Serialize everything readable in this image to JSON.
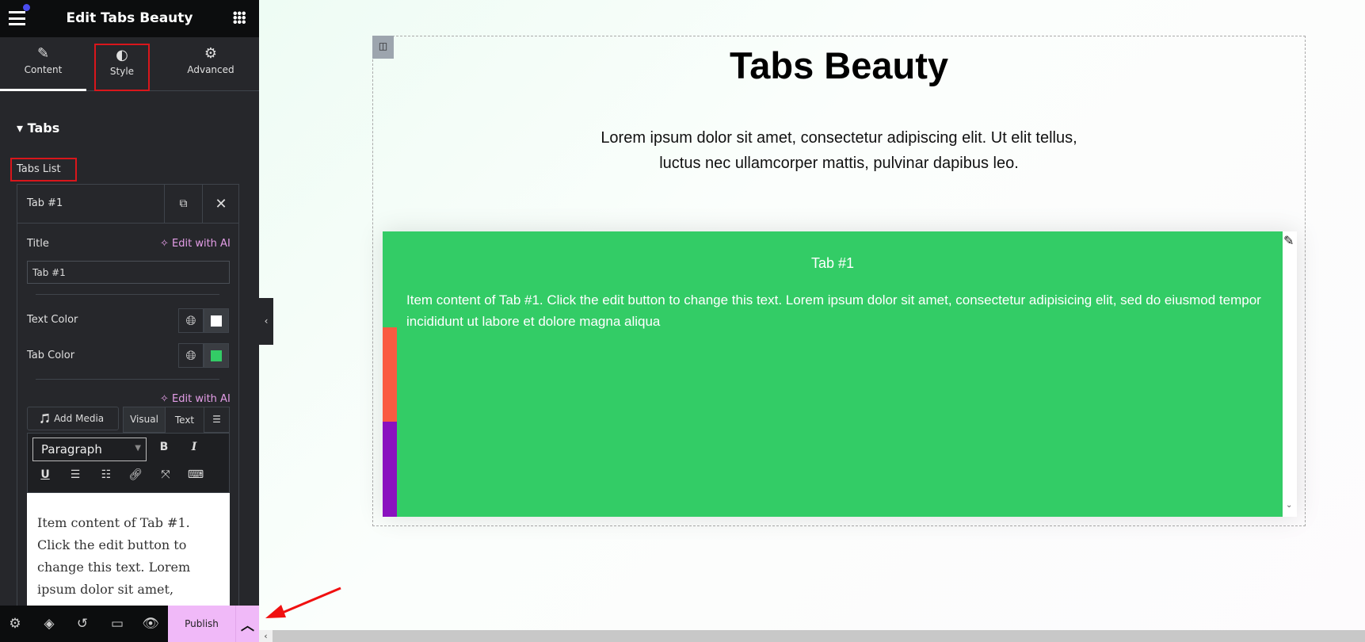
{
  "panel": {
    "title": "Edit Tabs Beauty",
    "tabs": [
      {
        "label": "Content",
        "icon": "pencil-icon"
      },
      {
        "label": "Style",
        "icon": "half-circle-icon"
      },
      {
        "label": "Advanced",
        "icon": "gear-icon"
      }
    ],
    "section": "Tabs",
    "tabs_list_label": "Tabs List",
    "item": {
      "title": "Tab #1",
      "field_title_label": "Title",
      "edit_ai": "Edit with AI",
      "title_value": "Tab #1",
      "text_color_label": "Text Color",
      "tab_color_label": "Tab Color",
      "text_color": "#ffffff",
      "tab_color": "#33cc66"
    },
    "editor": {
      "add_media": "Add Media",
      "visual": "Visual",
      "text": "Text",
      "format": "Paragraph",
      "content": "Item content of Tab #1. Click the edit button to change this text. Lorem ipsum dolor sit amet,"
    },
    "footer": {
      "publish": "Publish"
    }
  },
  "page": {
    "heading": "Tabs Beauty",
    "intro_line1": "Lorem ipsum dolor sit amet, consectetur adipiscing elit. Ut elit tellus,",
    "intro_line2": "luctus nec ullamcorper mattis, pulvinar dapibus leo.",
    "tab_label": "Tab #1",
    "tab_content": "Item content of Tab #1. Click the edit button to change this text. Lorem ipsum dolor sit amet, consectetur adipisicing elit, sed do eiusmod tempor incididunt ut labore et dolore magna aliqua",
    "colors": {
      "green": "#33cc66",
      "orange": "#fa5a41",
      "purple": "#8a12bf",
      "publish_bg": "#f0b9f8",
      "accent": "#d9161b"
    }
  }
}
